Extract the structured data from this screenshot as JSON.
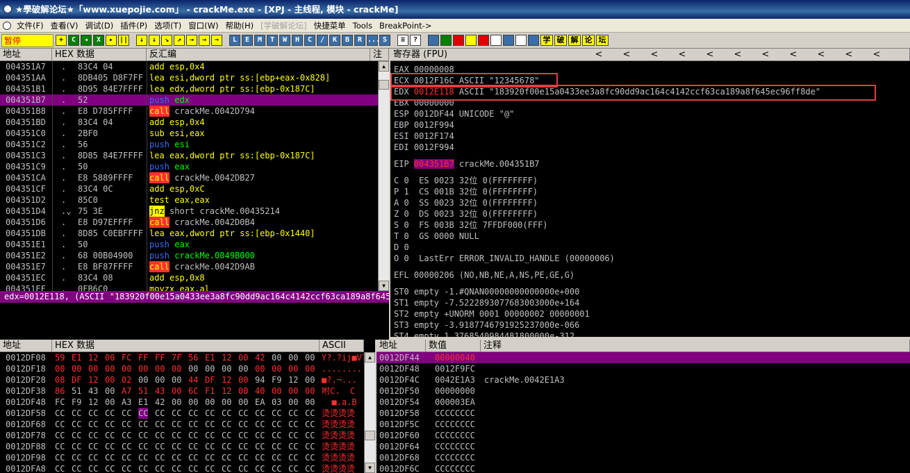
{
  "window": {
    "title": "★學破解论坛★「www.xuepojie.com」 - crackMe.exe - [XPJ - 主线程, 模块 - crackMe]"
  },
  "menu": [
    "文件(F)",
    "查看(V)",
    "调试(D)",
    "插件(P)",
    "选项(T)",
    "窗口(W)",
    "帮助(H)",
    "[学破解论坛]",
    "快捷菜单",
    "Tools",
    "BreakPoint->"
  ],
  "toolbar": {
    "status": "暂停",
    "buttons_a": [
      "+",
      "C",
      "◂",
      "X",
      "▸",
      "||"
    ],
    "buttons_b": [
      "↓",
      "↓",
      "↘",
      "↗",
      "→",
      "→",
      "⇒"
    ],
    "letters": [
      "L",
      "E",
      "M",
      "T",
      "W",
      "H",
      "C",
      "/",
      "K",
      "B",
      "R",
      "...",
      "S"
    ],
    "right": [
      "≡",
      "?"
    ],
    "cn": [
      "学",
      "破",
      "解",
      "论",
      "坛"
    ]
  },
  "cpu": {
    "headers": {
      "addr": "地址",
      "hex": "HEX 数据",
      "dis": "反汇编",
      "comment": "注"
    },
    "rows": [
      {
        "addr": "004351A7",
        "mark": ".",
        "hex": "83C4 04",
        "mn": "add",
        "ops": "esp,0x4",
        "cls": "norm"
      },
      {
        "addr": "004351AA",
        "mark": ".",
        "hex": "8DB405 D8F7FF",
        "mn": "lea",
        "ops": "esi,dword ptr ss:[ebp+eax-0x828]",
        "cls": "norm"
      },
      {
        "addr": "004351B1",
        "mark": ".",
        "hex": "8D95 84E7FFFF",
        "mn": "lea",
        "ops": "edx,dword ptr ss:[ebp-0x187C]",
        "cls": "norm"
      },
      {
        "addr": "004351B7",
        "mark": ".",
        "hex": "52",
        "mn": "push",
        "ops": "edx",
        "cls": "push",
        "sel": true
      },
      {
        "addr": "004351B8",
        "mark": ".",
        "hex": "E8 D785FFFF",
        "mn": "call",
        "ops": "crackMe.0042D794",
        "cls": "call"
      },
      {
        "addr": "004351BD",
        "mark": ".",
        "hex": "83C4 04",
        "mn": "add",
        "ops": "esp,0x4",
        "cls": "norm"
      },
      {
        "addr": "004351C0",
        "mark": ".",
        "hex": "2BF0",
        "mn": "sub",
        "ops": "esi,eax",
        "cls": "norm"
      },
      {
        "addr": "004351C2",
        "mark": ".",
        "hex": "56",
        "mn": "push",
        "ops": "esi",
        "cls": "push"
      },
      {
        "addr": "004351C3",
        "mark": ".",
        "hex": "8D85 84E7FFFF",
        "mn": "lea",
        "ops": "eax,dword ptr ss:[ebp-0x187C]",
        "cls": "norm"
      },
      {
        "addr": "004351C9",
        "mark": ".",
        "hex": "50",
        "mn": "push",
        "ops": "eax",
        "cls": "push"
      },
      {
        "addr": "004351CA",
        "mark": ".",
        "hex": "E8 5889FFFF",
        "mn": "call",
        "ops": "crackMe.0042DB27",
        "cls": "call"
      },
      {
        "addr": "004351CF",
        "mark": ".",
        "hex": "83C4 0C",
        "mn": "add",
        "ops": "esp,0xC",
        "cls": "norm"
      },
      {
        "addr": "004351D2",
        "mark": ".",
        "hex": "85C0",
        "mn": "test",
        "ops": "eax,eax",
        "cls": "norm"
      },
      {
        "addr": "004351D4",
        "mark": ".⌄",
        "hex": "75 3E",
        "mn": "jnz",
        "ops": "short crackMe.00435214",
        "cls": "jnz"
      },
      {
        "addr": "004351D6",
        "mark": ".",
        "hex": "E8 D97EFFFF",
        "mn": "call",
        "ops": "crackMe.0042D0B4",
        "cls": "call"
      },
      {
        "addr": "004351DB",
        "mark": ".",
        "hex": "8D85 C0EBFFFF",
        "mn": "lea",
        "ops": "eax,dword ptr ss:[ebp-0x1440]",
        "cls": "norm"
      },
      {
        "addr": "004351E1",
        "mark": ".",
        "hex": "50",
        "mn": "push",
        "ops": "eax",
        "cls": "push"
      },
      {
        "addr": "004351E2",
        "mark": ".",
        "hex": "68 00B04900",
        "mn": "push",
        "ops": "crackMe.0049B000",
        "cls": "push"
      },
      {
        "addr": "004351E7",
        "mark": ".",
        "hex": "E8 BF87FFFF",
        "mn": "call",
        "ops": "crackMe.0042D9AB",
        "cls": "call"
      },
      {
        "addr": "004351EC",
        "mark": ".",
        "hex": "83C4 08",
        "mn": "add",
        "ops": "esp,0x8",
        "cls": "norm"
      },
      {
        "addr": "004351EF",
        "mark": ".",
        "hex": "0FB6C0",
        "mn": "movzx",
        "ops": "eax,al",
        "cls": "norm"
      }
    ]
  },
  "info": {
    "text": "edx=0012E118, (ASCII \"183920f00e15a0433ee3a8fc90dd9ac164c4142ccf63ca189a8f645ec96ff8de\")"
  },
  "registers": {
    "header": "寄存器 (FPU)",
    "chevrons": [
      "<",
      "<",
      "<",
      "<",
      "<",
      "<",
      "<",
      "<",
      "<",
      "<",
      "<"
    ],
    "eax": "EAX 00000008",
    "ecx": "ECX 0012F16C ASCII \"12345678\"",
    "edx_label": "EDX ",
    "edx_val": "0012E118",
    "edx_rest": " ASCII \"183920f00e15a0433ee3a8fc90dd9ac164c4142ccf63ca189a8f645ec96ff8de\"",
    "ebx": "EBX 00000000",
    "esp": "ESP 0012DF44 UNICODE \"@\"",
    "ebp": "EBP 0012F994",
    "esi": "ESI 0012F174",
    "edi": "EDI 0012F994",
    "eip_label": "EIP ",
    "eip_val": "004351B7",
    "eip_rest": " crackMe.004351B7",
    "flags": [
      "C 0  ES 0023 32位 0(FFFFFFFF)",
      "P 1  CS 001B 32位 0(FFFFFFFF)",
      "A 0  SS 0023 32位 0(FFFFFFFF)",
      "Z 0  DS 0023 32位 0(FFFFFFFF)",
      "S 0  FS 003B 32位 7FFDF000(FFF)",
      "T 0  GS 0000 NULL",
      "D 0",
      "O 0  LastErr ERROR_INVALID_HANDLE (00000006)"
    ],
    "efl": "EFL 00000206 (NO,NB,NE,A,NS,PE,GE,G)",
    "fpu": [
      "ST0 empty -1.#QNAN00000000000000e+000",
      "ST1 empty -7.5222893077683003000e+164",
      "ST2 empty +UNORM 0001 00000002 00000001",
      "ST3 empty -3.9187746791925237000e-066",
      "ST4 empty 1.3768540984481800000e-312"
    ]
  },
  "dump": {
    "headers": {
      "addr": "地址",
      "hex": "HEX 数据",
      "ascii": "ASCII"
    },
    "rows": [
      {
        "addr": "0012DF08",
        "bytes": [
          "59",
          "E1",
          "12",
          "00",
          "FC",
          "FF",
          "FF",
          "7F",
          "56",
          "E1",
          "12",
          "00",
          "42",
          "00",
          "00",
          "00"
        ],
        "red": [
          0,
          1,
          2,
          3,
          4,
          5,
          6,
          7,
          8,
          9,
          10,
          11,
          12
        ],
        "ascii": "Y?.?ij■V?"
      },
      {
        "addr": "0012DF18",
        "bytes": [
          "00",
          "00",
          "00",
          "00",
          "00",
          "00",
          "00",
          "00",
          "00",
          "00",
          "00",
          "00",
          "00",
          "00",
          "00",
          "00"
        ],
        "red": [
          0,
          1,
          2,
          3,
          4,
          5,
          6,
          7,
          12,
          13,
          14,
          15
        ],
        "ascii": "........"
      },
      {
        "addr": "0012DF28",
        "bytes": [
          "08",
          "DF",
          "12",
          "00",
          "02",
          "00",
          "00",
          "00",
          "44",
          "DF",
          "12",
          "00",
          "94",
          "F9",
          "12",
          "00"
        ],
        "red": [
          0,
          1,
          2,
          3,
          4,
          8,
          9,
          10,
          11
        ],
        "ascii": "■?.¬..."
      },
      {
        "addr": "0012DF38",
        "bytes": [
          "86",
          "51",
          "43",
          "00",
          "A7",
          "51",
          "43",
          "00",
          "6C",
          "F1",
          "12",
          "00",
          "40",
          "00",
          "00",
          "00"
        ],
        "red": [
          0,
          4,
          5,
          6,
          7,
          8,
          9,
          10,
          11,
          12,
          13,
          14,
          15
        ],
        "ascii": "咐C.  C"
      },
      {
        "addr": "0012DF48",
        "bytes": [
          "FC",
          "F9",
          "12",
          "00",
          "A3",
          "E1",
          "42",
          "00",
          "00",
          "00",
          "00",
          "00",
          "EA",
          "03",
          "00",
          "00"
        ],
        "red": [],
        "ascii": "  ■.a.B"
      },
      {
        "addr": "0012DF58",
        "bytes": [
          "CC",
          "CC",
          "CC",
          "CC",
          "CC",
          "CC",
          "CC",
          "CC",
          "CC",
          "CC",
          "CC",
          "CC",
          "CC",
          "CC",
          "CC",
          "CC"
        ],
        "red": [],
        "ascii": "烫烫烫烫"
      },
      {
        "addr": "0012DF68",
        "bytes": [
          "CC",
          "CC",
          "CC",
          "CC",
          "CC",
          "CC",
          "CC",
          "CC",
          "CC",
          "CC",
          "CC",
          "CC",
          "CC",
          "CC",
          "CC",
          "CC"
        ],
        "red": [],
        "ascii": "烫烫烫烫"
      },
      {
        "addr": "0012DF78",
        "bytes": [
          "CC",
          "CC",
          "CC",
          "CC",
          "CC",
          "CC",
          "CC",
          "CC",
          "CC",
          "CC",
          "CC",
          "CC",
          "CC",
          "CC",
          "CC",
          "CC"
        ],
        "red": [],
        "ascii": "烫烫烫烫"
      },
      {
        "addr": "0012DF88",
        "bytes": [
          "CC",
          "CC",
          "CC",
          "CC",
          "CC",
          "CC",
          "CC",
          "CC",
          "CC",
          "CC",
          "CC",
          "CC",
          "CC",
          "CC",
          "CC",
          "CC"
        ],
        "red": [],
        "ascii": "烫烫烫烫"
      },
      {
        "addr": "0012DF98",
        "bytes": [
          "CC",
          "CC",
          "CC",
          "CC",
          "CC",
          "CC",
          "CC",
          "CC",
          "CC",
          "CC",
          "CC",
          "CC",
          "CC",
          "CC",
          "CC",
          "CC"
        ],
        "red": [],
        "ascii": "烫烫烫烫"
      },
      {
        "addr": "0012DFA8",
        "bytes": [
          "CC",
          "CC",
          "CC",
          "CC",
          "CC",
          "CC",
          "CC",
          "CC",
          "CC",
          "CC",
          "CC",
          "CC",
          "CC",
          "CC",
          "CC",
          "CC"
        ],
        "red": [],
        "ascii": "烫烫烫烫"
      }
    ]
  },
  "stack": {
    "headers": {
      "addr": "地址",
      "val": "数值",
      "comment": "注释"
    },
    "rows": [
      {
        "addr": "0012DF44",
        "val": "00000040",
        "comment": "",
        "sel": true
      },
      {
        "addr": "0012DF48",
        "val": "0012F9FC",
        "comment": ""
      },
      {
        "addr": "0012DF4C",
        "val": "0042E1A3",
        "comment": "crackMe.0042E1A3"
      },
      {
        "addr": "0012DF50",
        "val": "00000000",
        "comment": ""
      },
      {
        "addr": "0012DF54",
        "val": "000003EA",
        "comment": ""
      },
      {
        "addr": "0012DF58",
        "val": "CCCCCCCC",
        "comment": ""
      },
      {
        "addr": "0012DF5C",
        "val": "CCCCCCCC",
        "comment": ""
      },
      {
        "addr": "0012DF60",
        "val": "CCCCCCCC",
        "comment": ""
      },
      {
        "addr": "0012DF64",
        "val": "CCCCCCCC",
        "comment": ""
      },
      {
        "addr": "0012DF68",
        "val": "CCCCCCCC",
        "comment": ""
      },
      {
        "addr": "0012DF6C",
        "val": "CCCCCCCC",
        "comment": ""
      }
    ]
  },
  "colors": {
    "selection": "#800080",
    "call_bg": "#ff3030",
    "jnz_bg": "#ffff00",
    "push": "#3a6eff",
    "mnemonic": "#ffff00",
    "highlight_box": "#e04040"
  }
}
